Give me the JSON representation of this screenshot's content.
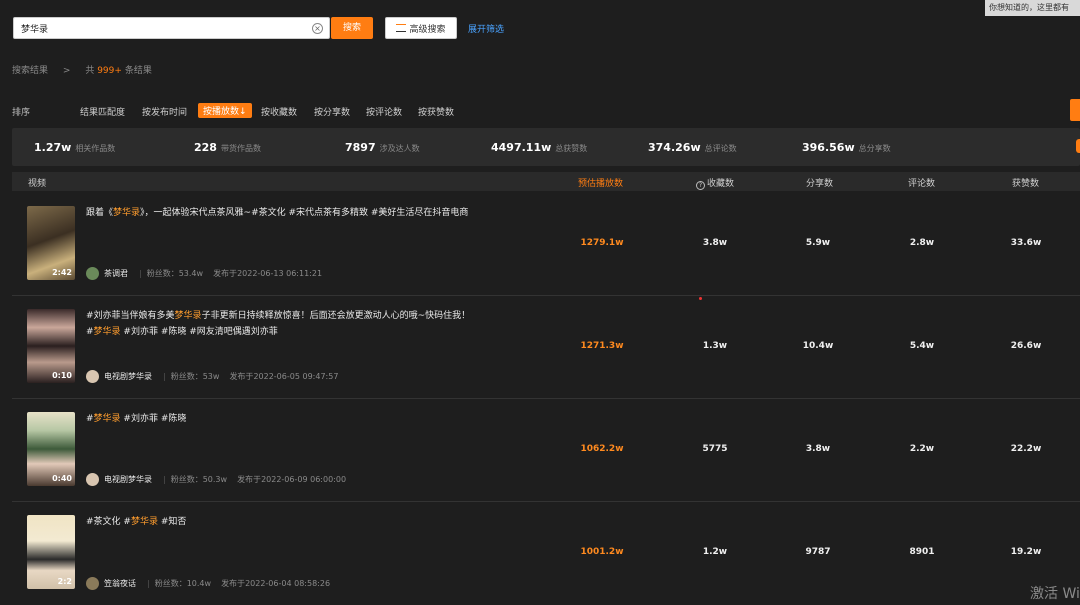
{
  "search": {
    "value": "梦华录",
    "button_label": "搜索",
    "advanced_label": "高级搜索",
    "expand_label": "展开筛选"
  },
  "tooltip": "你想知道的，这里都有",
  "breadcrumb": {
    "label": "搜索结果",
    "sep": ">",
    "count_prefix": "共",
    "count": "999+",
    "count_suffix": "条结果"
  },
  "sort": {
    "title": "排序",
    "options": [
      "结果匹配度",
      "按发布时间",
      "按播放数↓",
      "按收藏数",
      "按分享数",
      "按评论数",
      "按获赞数"
    ],
    "active_index": 2
  },
  "stats": [
    {
      "value": "1.27w",
      "label": "相关作品数"
    },
    {
      "value": "228",
      "label": "带货作品数"
    },
    {
      "value": "7897",
      "label": "涉及达人数"
    },
    {
      "value": "4497.11w",
      "label": "总获赞数"
    },
    {
      "value": "374.26w",
      "label": "总评论数"
    },
    {
      "value": "396.56w",
      "label": "总分享数"
    }
  ],
  "table": {
    "headers": {
      "video": "视频",
      "plays": "预估播放数",
      "favorites": "收藏数",
      "shares": "分享数",
      "comments": "评论数",
      "likes": "获赞数"
    },
    "rows": [
      {
        "title_pre": "跟着《",
        "title_hl": "梦华录",
        "title_post": "》，一起体验宋代点茶风雅~#茶文化 #宋代点茶有多精致 #美好生活尽在抖音电商",
        "duration": "2:42",
        "author": "茶调君",
        "fans_label": "粉丝数：",
        "fans": "53.4w",
        "pub_label": "发布于",
        "pub": "2022-06-13 06:11:21",
        "plays": "1279.1w",
        "favorites": "3.8w",
        "shares": "5.9w",
        "comments": "2.8w",
        "likes": "33.6w"
      },
      {
        "title_pre": "#刘亦菲当伴娘有多美",
        "title_hl": "梦华录",
        "title_post": "子非更新日持续释放惊喜！后面还会放更激动人心的哦~快码住我！#",
        "title_hl2": "梦华录",
        "title_post2": " #刘亦菲 #陈晓 #网友清吧偶遇刘亦菲",
        "duration": "0:10",
        "author": "电视剧梦华录",
        "fans_label": "粉丝数：",
        "fans": "53w",
        "pub_label": "发布于",
        "pub": "2022-06-05 09:47:57",
        "plays": "1271.3w",
        "favorites": "1.3w",
        "shares": "10.4w",
        "comments": "5.4w",
        "likes": "26.6w"
      },
      {
        "title_pre": "#",
        "title_hl": "梦华录",
        "title_post": " #刘亦菲 #陈晓",
        "duration": "0:40",
        "author": "电视剧梦华录",
        "fans_label": "粉丝数：",
        "fans": "50.3w",
        "pub_label": "发布于",
        "pub": "2022-06-09 06:00:00",
        "plays": "1062.2w",
        "favorites": "5775",
        "shares": "3.8w",
        "comments": "2.2w",
        "likes": "22.2w"
      },
      {
        "title_pre": "#茶文化 #",
        "title_hl": "梦华录",
        "title_post": " #知否",
        "duration": "2:2",
        "author": "笠翁夜话",
        "fans_label": "粉丝数：",
        "fans": "10.4w",
        "pub_label": "发布于",
        "pub": "2022-06-04 08:58:26",
        "plays": "1001.2w",
        "favorites": "1.2w",
        "shares": "9787",
        "comments": "8901",
        "likes": "19.2w"
      }
    ]
  },
  "watermark": "激活 Wi",
  "colors": {
    "accent": "#ff7d12",
    "highlight": "#ff9d2e",
    "link": "#4aa3ff",
    "background": "#1e1e1e"
  }
}
